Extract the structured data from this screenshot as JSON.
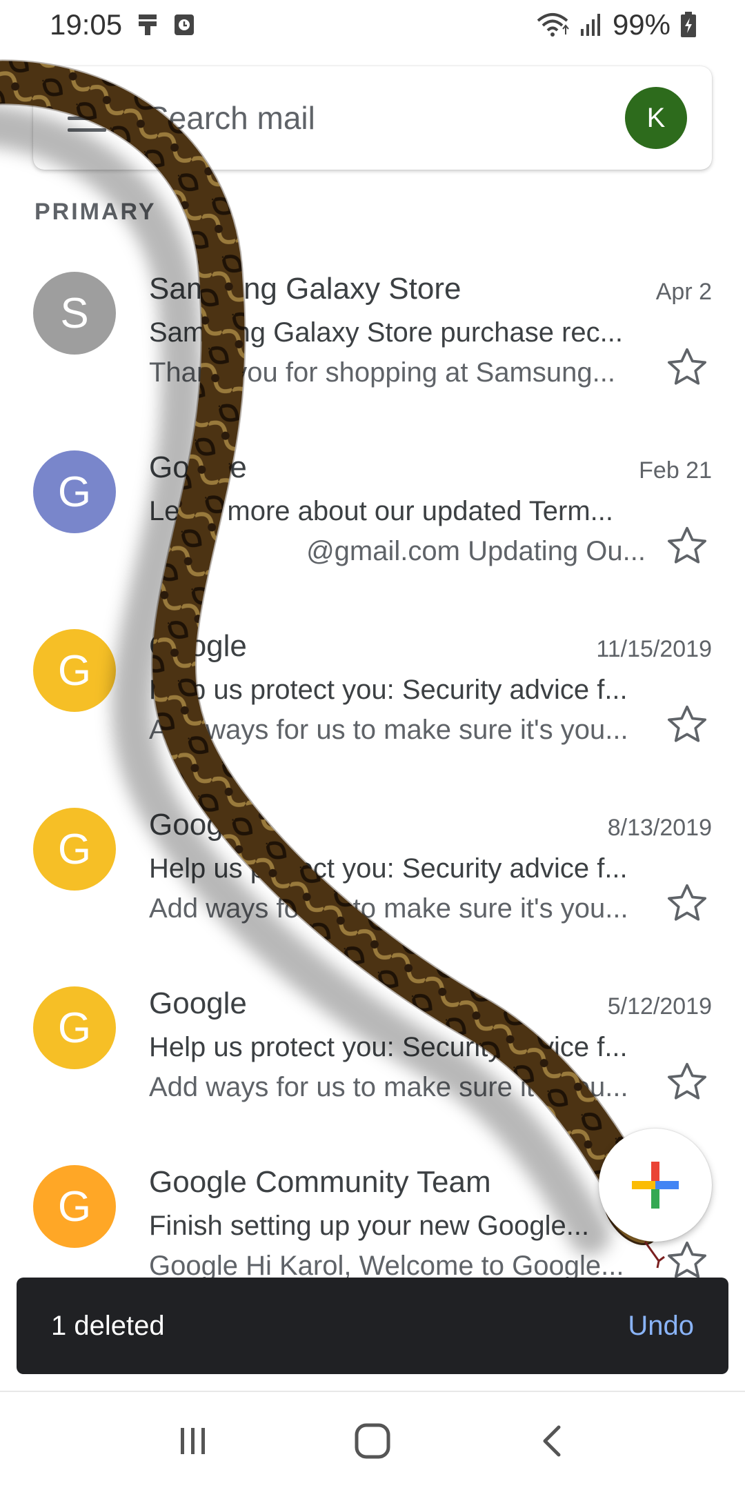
{
  "status_bar": {
    "time": "19:05",
    "battery": "99%",
    "icons": [
      "notification-icon",
      "alarm-icon",
      "wifi-icon",
      "signal-icon",
      "battery-charging-icon"
    ]
  },
  "search": {
    "placeholder": "Search mail",
    "avatar_letter": "K",
    "avatar_color": "#2d6b1c"
  },
  "section": {
    "label": "PRIMARY"
  },
  "emails": [
    {
      "avatar": "S",
      "color": "#9e9e9e",
      "sender": "Samsung Galaxy Store",
      "date": "Apr 2",
      "subject": "Samsung Galaxy Store purchase rec...",
      "snippet": "Thank you for shopping at Samsung..."
    },
    {
      "avatar": "G",
      "color": "#7986cb",
      "sender": "Google",
      "date": "Feb 21",
      "subject": "Learn more about our updated Term...",
      "snippet": "@gmail.com Updating Ou..."
    },
    {
      "avatar": "G",
      "color": "#f6bf26",
      "sender": "Google",
      "date": "11/15/2019",
      "subject": "Help us protect you: Security advice f...",
      "snippet": "Add ways for us to make sure it's you..."
    },
    {
      "avatar": "G",
      "color": "#f6bf26",
      "sender": "Google",
      "date": "8/13/2019",
      "subject": "Help us protect you: Security advice f...",
      "snippet": "Add ways for us to make sure it's you..."
    },
    {
      "avatar": "G",
      "color": "#f6bf26",
      "sender": "Google",
      "date": "5/12/2019",
      "subject": "Help us protect you: Security advice f...",
      "snippet": "Add ways for us to make sure it's you..."
    },
    {
      "avatar": "G",
      "color": "#ffa726",
      "sender": "Google Community Team",
      "date": "",
      "subject": "Finish setting up your new Google...",
      "snippet": "Google Hi Karol, Welcome to Google..."
    }
  ],
  "snackbar": {
    "message": "1 deleted",
    "action": "Undo"
  },
  "fab": {
    "icon": "compose-plus-icon"
  },
  "nav": {
    "icons": [
      "recents-icon",
      "home-icon",
      "back-icon"
    ]
  }
}
